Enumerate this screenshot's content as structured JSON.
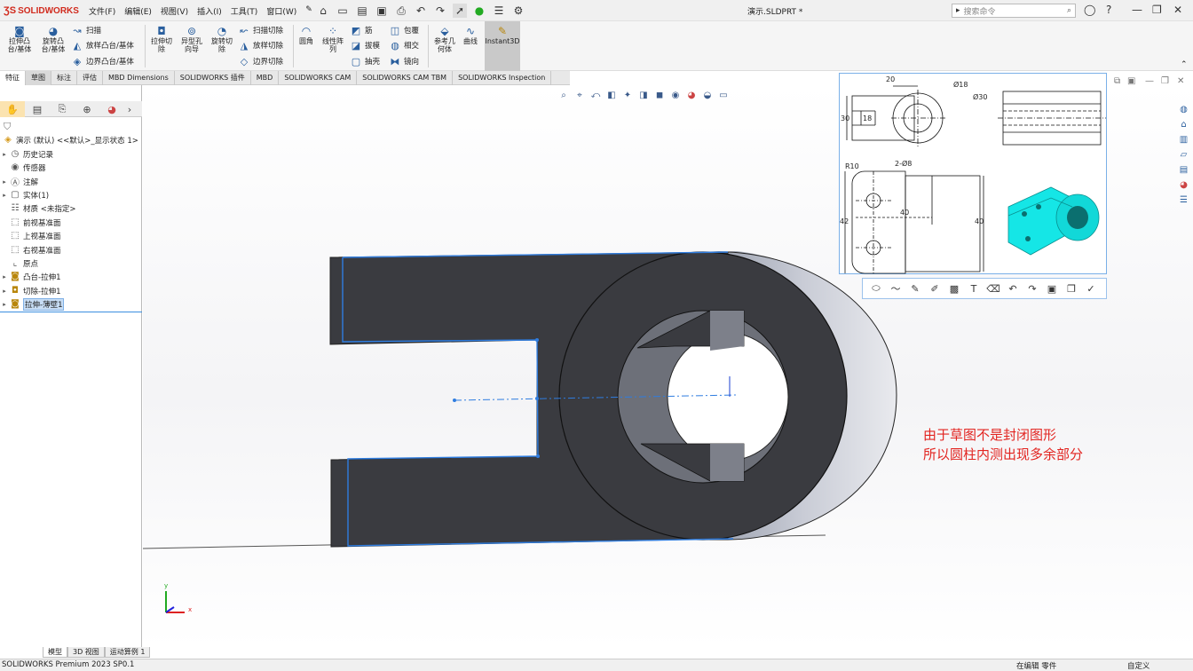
{
  "app": {
    "logo_text": "SOLIDWORKS",
    "doc_title": "演示.SLDPRT *"
  },
  "menus": [
    "文件(F)",
    "编辑(E)",
    "视图(V)",
    "插入(I)",
    "工具(T)",
    "窗口(W)"
  ],
  "search": {
    "placeholder": "搜索命令"
  },
  "commands": {
    "extrude_boss": "拉伸凸\n台/基体",
    "revolve_boss": "旋转凸\n台/基体",
    "sweep": "扫描",
    "loft": "放样凸台/基体",
    "boundary_boss": "边界凸台/基体",
    "extrude_cut": "拉伸切\n除",
    "hole_wizard": "异型孔\n向导",
    "revolve_cut": "旋转切\n除",
    "swept_cut": "扫描切除",
    "lofted_cut": "放样切除",
    "boundary_cut": "边界切除",
    "fillet": "圆角",
    "linear_pattern": "线性阵\n列",
    "rib": "筋",
    "wrap": "包覆",
    "draft": "拔模",
    "intersect": "相交",
    "shell": "抽壳",
    "mirror": "镜向",
    "ref_geometry": "参考几\n何体",
    "curves": "曲线",
    "instant3d": "Instant3D"
  },
  "tabs": [
    "特征",
    "草图",
    "标注",
    "评估",
    "MBD Dimensions",
    "SOLIDWORKS 插件",
    "MBD",
    "SOLIDWORKS CAM",
    "SOLIDWORKS CAM TBM",
    "SOLIDWORKS Inspection"
  ],
  "tree": {
    "root": "演示 (默认) <<默认>_显示状态 1>",
    "items": [
      "历史记录",
      "传感器",
      "注解",
      "实体(1)",
      "材质 <未指定>",
      "前视基准面",
      "上视基准面",
      "右视基准面",
      "原点",
      "凸台-拉伸1",
      "切除-拉伸1",
      "拉伸-薄壁1"
    ]
  },
  "drawing": {
    "dims": [
      "20",
      "Ø18",
      "Ø30",
      "30",
      "18",
      "R10",
      "2-Ø8",
      "42",
      "40",
      "40"
    ]
  },
  "annotation": {
    "line1": "由于草图不是封闭图形",
    "line2": "所以圆柱内测出现多余部分"
  },
  "triad": {
    "x": "x",
    "y": "y"
  },
  "bottom_tabs": [
    "模型",
    "3D 视图",
    "运动算例 1"
  ],
  "status": {
    "left": "SOLIDWORKS Premium 2023 SP0.1",
    "edit": "在编辑 零件",
    "custom": "自定义"
  },
  "colors": {
    "part_face": "#3a3b40",
    "sketch_line": "#2f7de0",
    "annotation": "#e22420",
    "iso_model": "#15e6e6"
  }
}
